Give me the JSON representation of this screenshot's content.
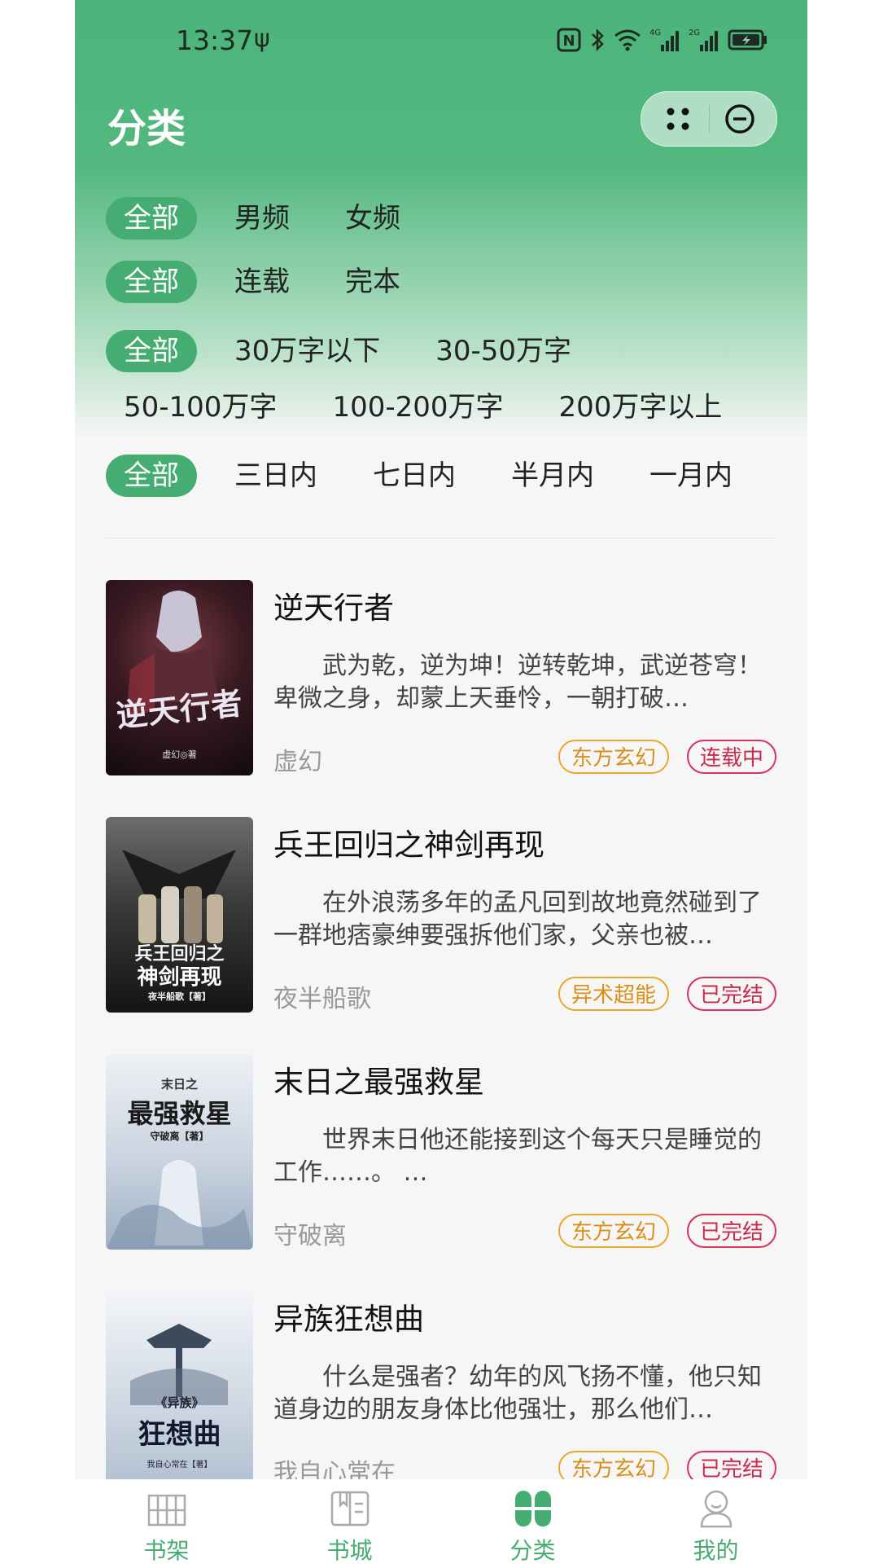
{
  "status_bar": {
    "time": "13:37",
    "usb": "ψ",
    "nfc": "N",
    "network_4g": "4G",
    "network_2g": "2G"
  },
  "header": {
    "title": "分类"
  },
  "filters": {
    "gender": [
      "全部",
      "男频",
      "女频"
    ],
    "status": [
      "全部",
      "连载",
      "完本"
    ],
    "length_row1": [
      "全部",
      "30万字以下",
      "30-50万字"
    ],
    "length_row2": [
      "50-100万字",
      "100-200万字",
      "200万字以上"
    ],
    "updated": [
      "全部",
      "三日内",
      "七日内",
      "半月内",
      "一月内"
    ]
  },
  "books": [
    {
      "title": "逆天行者",
      "desc": "武为乾，逆为坤！逆转乾坤，武逆苍穹！卑微之身，却蒙上天垂怜，一朝打破…",
      "author": "虚幻",
      "genre": "东方玄幻",
      "status": "连载中",
      "cover_title": "逆天行者",
      "cover_author": "虚幻◎著"
    },
    {
      "title": "兵王回归之神剑再现",
      "desc": "在外浪荡多年的孟凡回到故地竟然碰到了一群地痞豪绅要强拆他们家，父亲也被…",
      "author": "夜半船歌",
      "genre": "异术超能",
      "status": "已完结",
      "cover_title": "兵王回归之",
      "cover_title2": "神剑再现",
      "cover_author": "夜半船歌【著】"
    },
    {
      "title": "末日之最强救星",
      "desc": "世界末日他还能接到这个每天只是睡觉的工作……。 …",
      "author": "守破离",
      "genre": "东方玄幻",
      "status": "已完结",
      "cover_title": "末日之",
      "cover_title2": "最强救星",
      "cover_author": "守破离【著】"
    },
    {
      "title": "异族狂想曲",
      "desc": "什么是强者？幼年的风飞扬不懂，他只知道身边的朋友身体比他强壮，那么他们…",
      "author": "我自心常在",
      "genre": "东方玄幻",
      "status": "已完结",
      "cover_title": "《异族》",
      "cover_title2": "狂想曲",
      "cover_author": "我自心常在【著】"
    }
  ],
  "tabbar": [
    {
      "label": "书架",
      "icon": "bookshelf-icon"
    },
    {
      "label": "书城",
      "icon": "book-open-icon"
    },
    {
      "label": "分类",
      "icon": "clover-icon"
    },
    {
      "label": "我的",
      "icon": "profile-icon"
    }
  ],
  "colors": {
    "primary": "#45ad72",
    "genre_tag": "#e8a92c",
    "status_tag": "#d7335a"
  }
}
